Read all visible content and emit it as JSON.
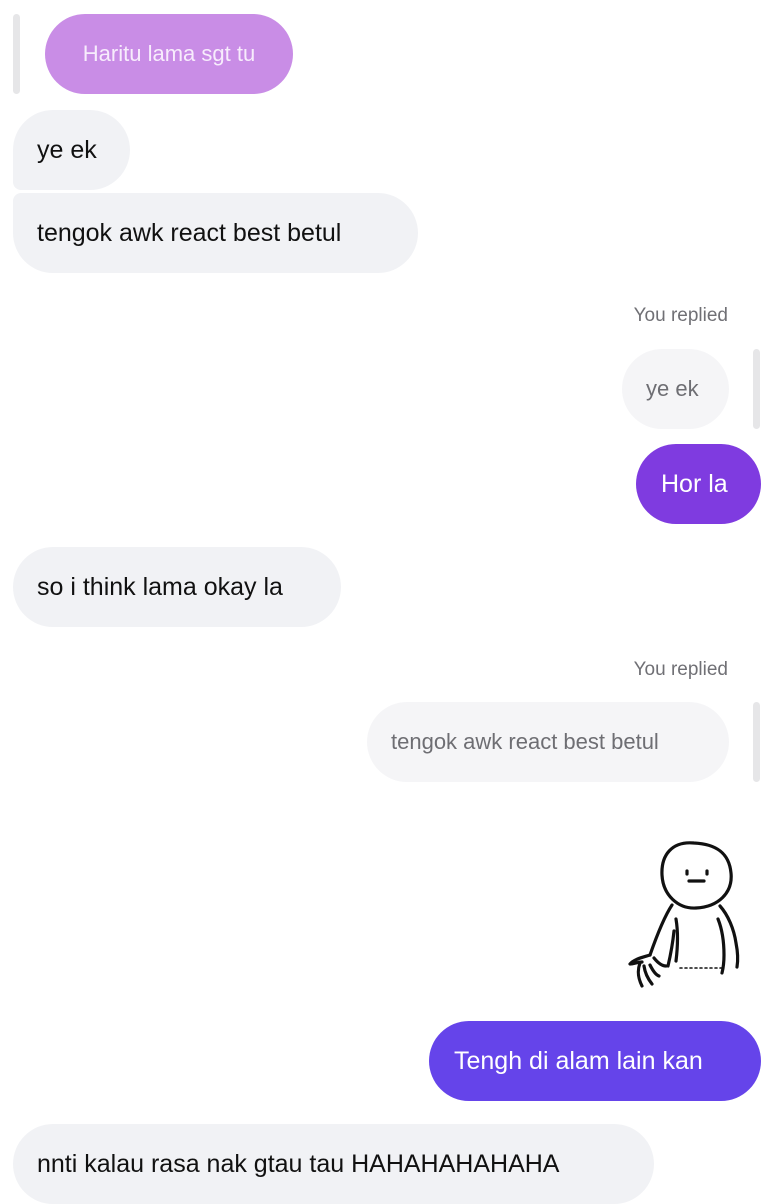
{
  "messages": {
    "m1_quoted": "Haritu lama sgt tu",
    "m2": "ye ek",
    "m3": "tengok awk react best betul",
    "m4_replied_label": "You replied",
    "m4_quoted": "ye ek",
    "m5": "Hor la",
    "m6": "so i think lama okay la",
    "m7_replied_label": "You replied",
    "m7_quoted": "tengok awk react best betul",
    "m8_sticker": "sticker-stick-figure",
    "m9": "Tengh di alam lain kan",
    "m10": "nnti kalau rasa nak gtau tau HAHAHAHAHAHA"
  },
  "colors": {
    "incoming_bg": "#f1f2f5",
    "quote_pink": "#c98de6",
    "outgoing_purple": "#7f3be0",
    "outgoing_indigo": "#6544ea",
    "reply_bar": "#e6e6e8"
  }
}
